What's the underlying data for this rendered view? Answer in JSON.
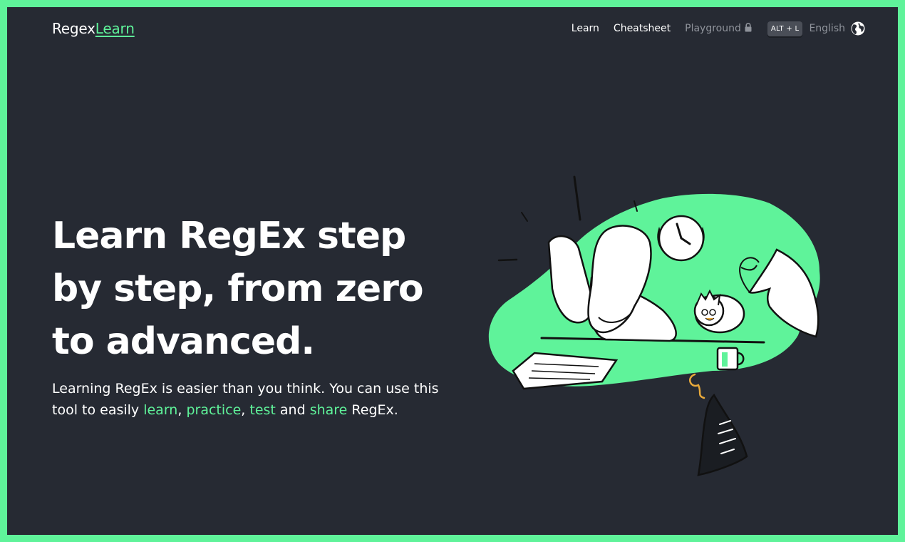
{
  "header": {
    "logo_part1": "Regex",
    "logo_part2": "Learn",
    "nav": {
      "learn": "Learn",
      "cheatsheet": "Cheatsheet",
      "playground": "Playground",
      "shortcut": "ALT + L",
      "language": "English"
    }
  },
  "hero": {
    "title": "Learn RegEx step by step, from zero to advanced.",
    "desc_prefix": "Learning RegEx is easier than you think. You can use this tool to easily ",
    "link_learn": "learn",
    "sep1": ", ",
    "link_practice": "practice",
    "sep2": ", ",
    "link_test": "test",
    "sep3": " and ",
    "link_share": "share",
    "desc_suffix": " RegEx."
  },
  "colors": {
    "background": "#262a33",
    "accent": "#5ff39a",
    "text": "#ffffff",
    "muted": "#8f939b"
  },
  "icons": [
    "lock-icon",
    "globe-icon"
  ]
}
